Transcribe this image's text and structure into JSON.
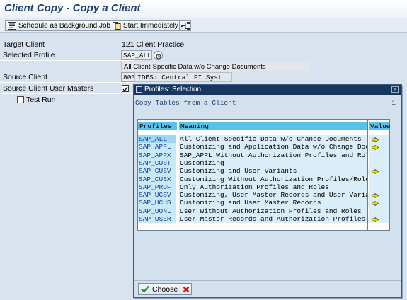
{
  "window": {
    "title": "Client Copy - Copy a Client"
  },
  "toolbar": {
    "schedule_label": "Schedule as Background Job",
    "start_label": "Start Immediately"
  },
  "form": {
    "target_client_label": "Target Client",
    "target_client_value": "121 Client Practice",
    "selected_profile_label": "Selected Profile",
    "selected_profile_value": "SAP_ALL",
    "profile_description": "All Client-Specific Data w/o Change Documents",
    "source_client_label": "Source Client",
    "source_client_value": "800",
    "source_client_description": "IDES: Central FI Syst",
    "source_user_masters_label": "Source Client User Masters",
    "test_run_label": "Test Run"
  },
  "dialog": {
    "title": "Profiles: Selection",
    "header_text": "Copy Tables from a Client",
    "header_count": "1",
    "columns": {
      "profiles": "Profiles",
      "meaning": "Meaning",
      "value": "Value"
    },
    "rows": [
      {
        "profile": "SAP_ALL",
        "meaning": "All Client-Specific Data w/o Change Documents",
        "has_value": true
      },
      {
        "profile": "SAP_APPL",
        "meaning": "Customizing and Application Data w/o Change Docs",
        "has_value": true
      },
      {
        "profile": "SAP_APPX",
        "meaning": "SAP_APPL Without Authorization Profiles and Roles",
        "has_value": false
      },
      {
        "profile": "SAP_CUST",
        "meaning": "Customizing",
        "has_value": false
      },
      {
        "profile": "SAP_CUSV",
        "meaning": "Customizing and User Variants",
        "has_value": true
      },
      {
        "profile": "SAP_CUSX",
        "meaning": "Customizing Without Authorization Profiles/Roles",
        "has_value": false
      },
      {
        "profile": "SAP_PROF",
        "meaning": "Only Authorization Profiles and Roles",
        "has_value": false
      },
      {
        "profile": "SAP_UCSV",
        "meaning": "Customizing, User Master Records and User Variants",
        "has_value": true
      },
      {
        "profile": "SAP_UCUS",
        "meaning": "Customizing and User Master Records",
        "has_value": true
      },
      {
        "profile": "SAP_UONL",
        "meaning": "User Without Authorization Profiles and Roles",
        "has_value": false
      },
      {
        "profile": "SAP_USER",
        "meaning": "User Master Records and Authorization Profiles",
        "has_value": true
      }
    ],
    "choose_label": "Choose"
  },
  "colors": {
    "title": "#1f3f6f",
    "dialog_title_bg": "#17375f",
    "header_cell": "#5ac2ea",
    "arrow": "#f5e400"
  }
}
